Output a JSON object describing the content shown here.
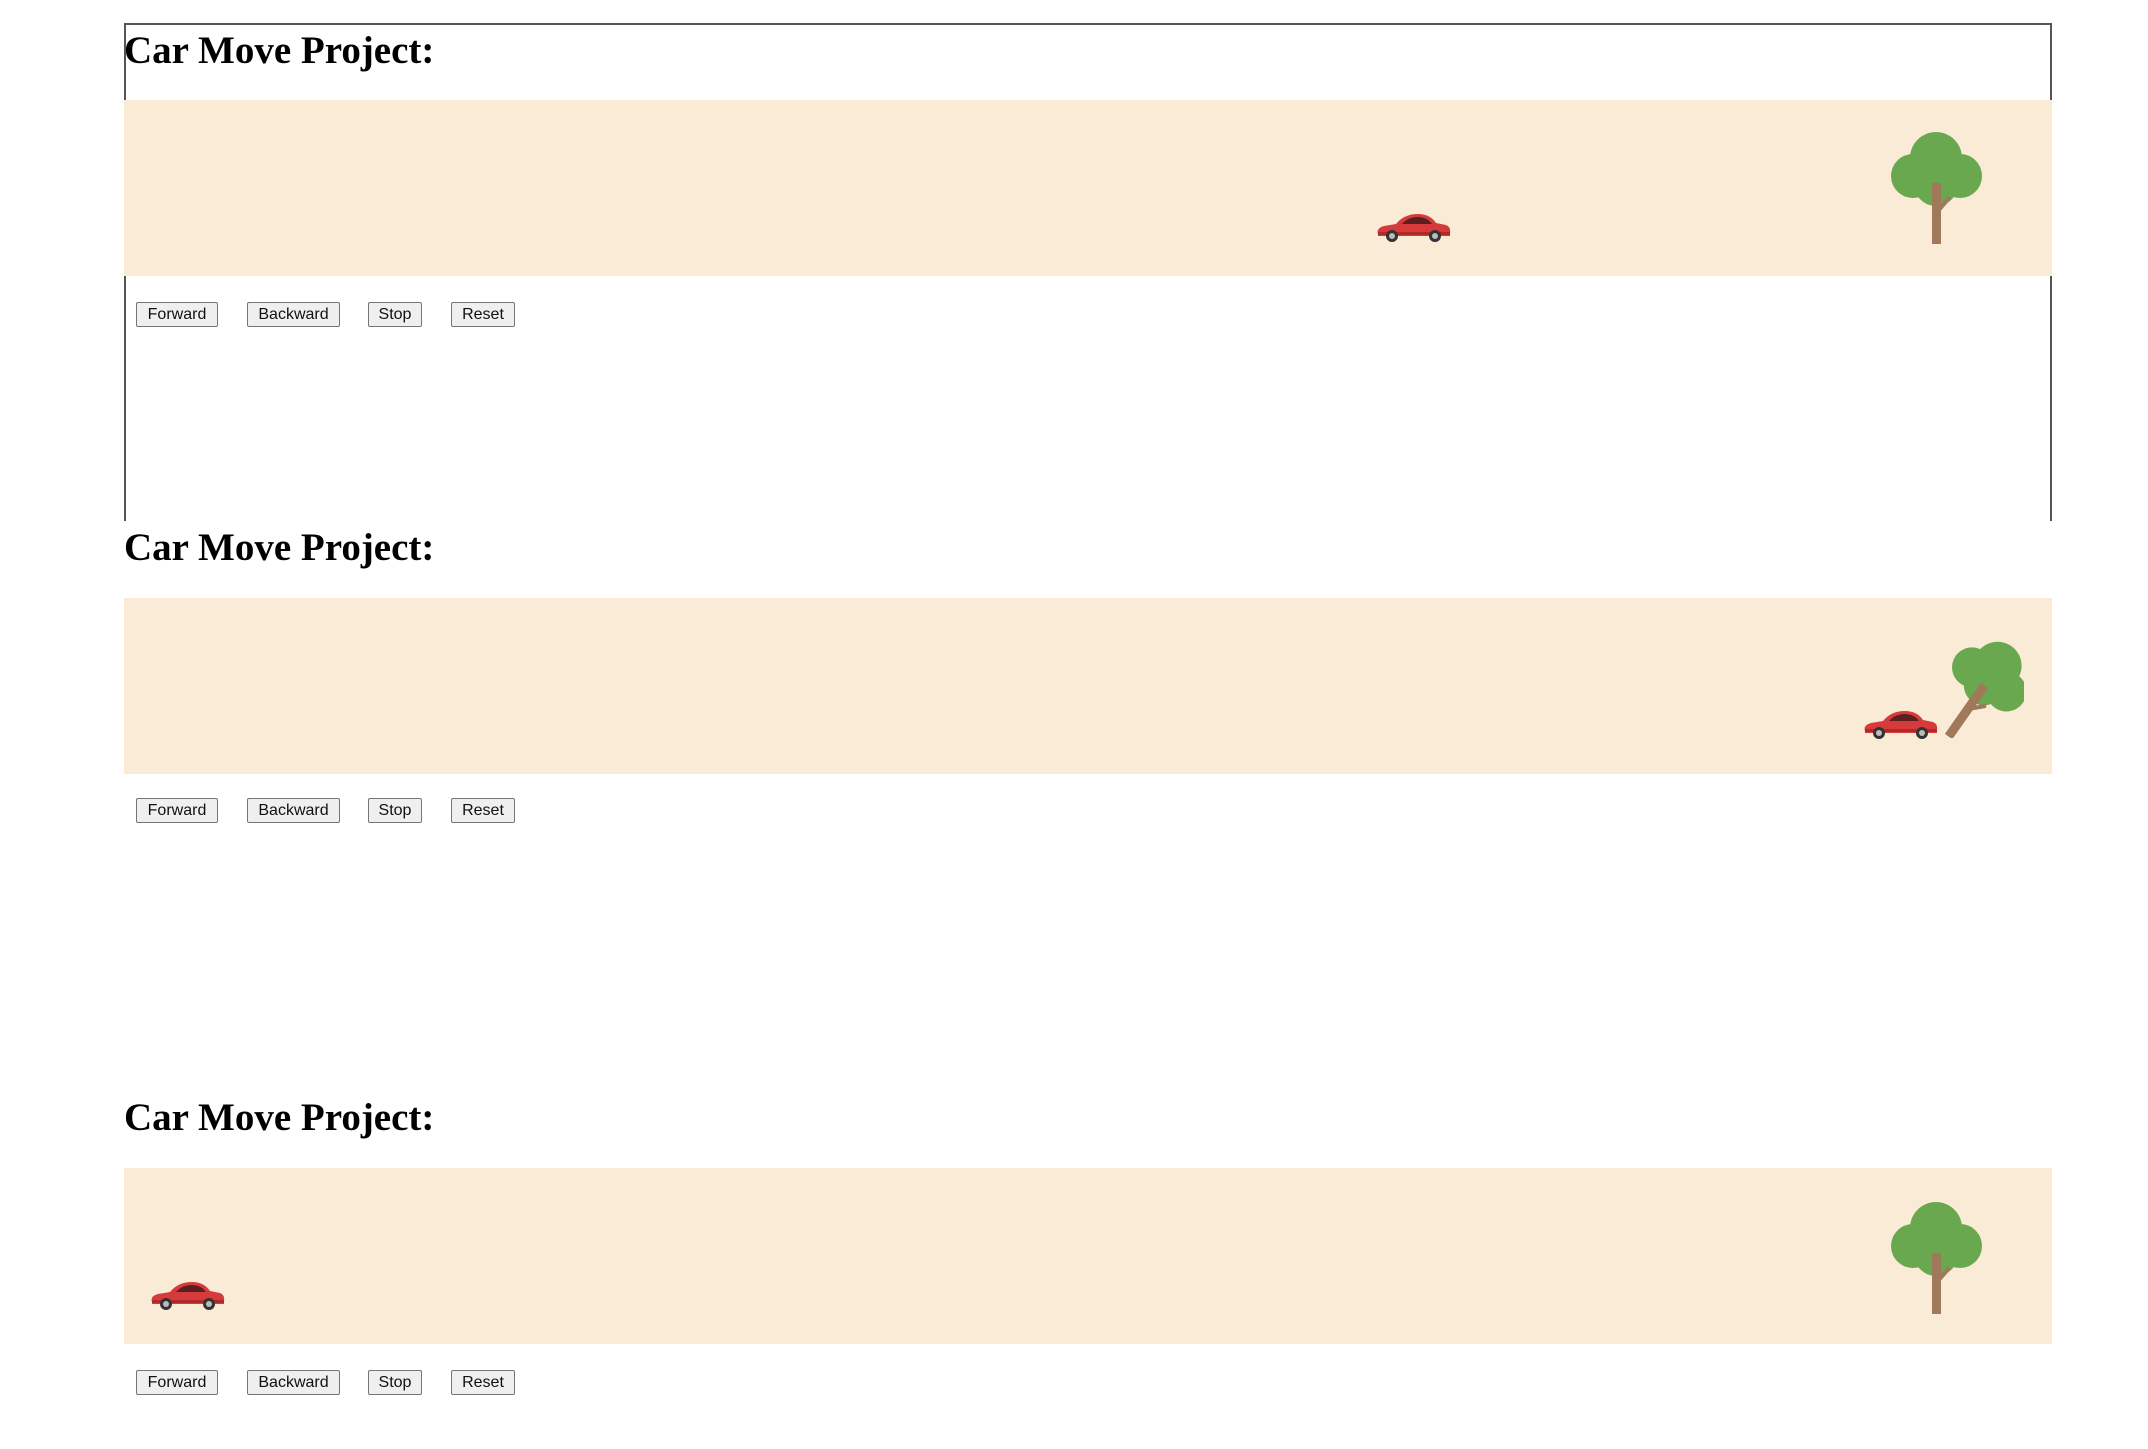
{
  "panels": [
    {
      "title": "Car Move Project:",
      "buttons": {
        "forward": "Forward",
        "backward": "Backward",
        "stop": "Stop",
        "reset": "Reset"
      },
      "car_state": "moving",
      "tree_state": "standing"
    },
    {
      "title": "Car Move Project:",
      "buttons": {
        "forward": "Forward",
        "backward": "Backward",
        "stop": "Stop",
        "reset": "Reset"
      },
      "car_state": "crashed",
      "tree_state": "knocked-over"
    },
    {
      "title": "Car Move Project:",
      "buttons": {
        "forward": "Forward",
        "backward": "Backward",
        "stop": "Stop",
        "reset": "Reset"
      },
      "car_state": "start-position",
      "tree_state": "standing"
    }
  ],
  "colors": {
    "track": "#faebd7",
    "car": "#d63a3a",
    "tree_foliage": "#6aa84f",
    "tree_trunk": "#a0785a"
  },
  "icons": {
    "car": "red-car-icon",
    "tree": "tree-icon"
  }
}
